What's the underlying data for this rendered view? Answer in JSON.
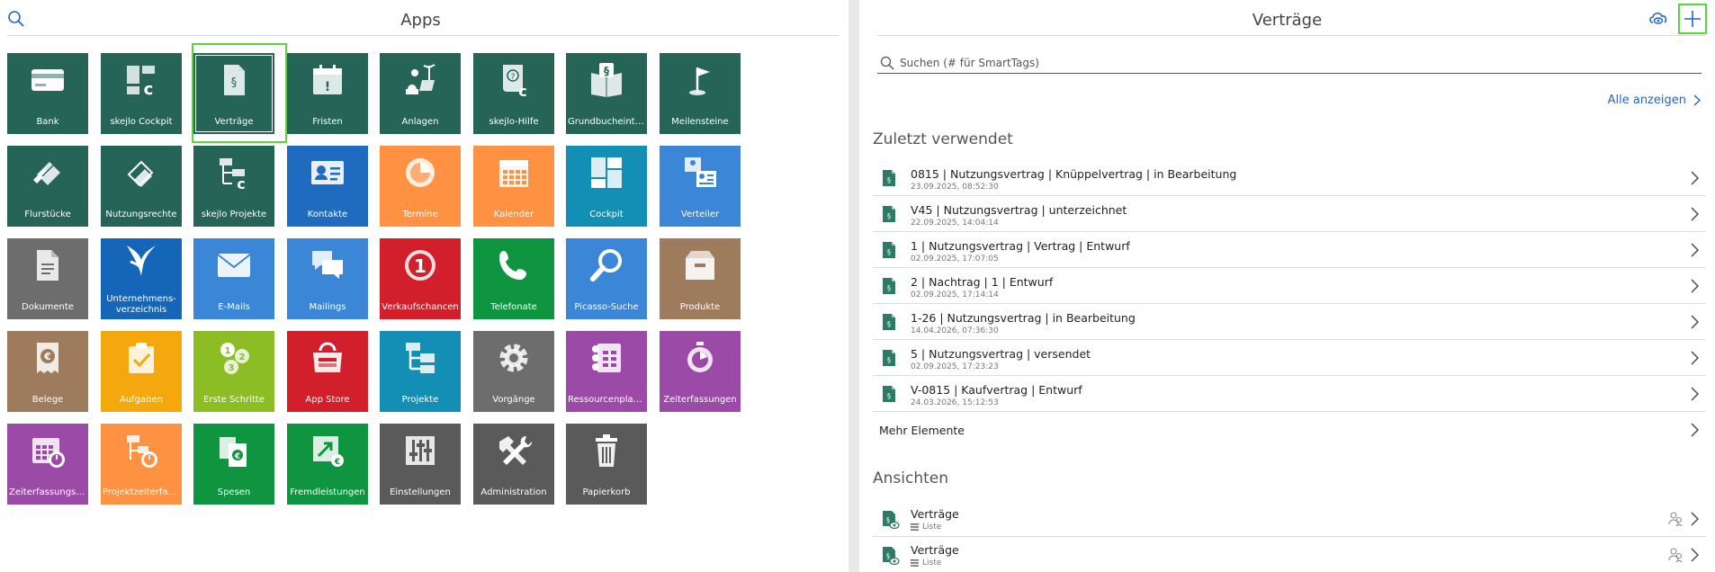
{
  "apps_panel": {
    "title": "Apps",
    "tiles": [
      {
        "label": "Bank",
        "color": "#256456",
        "icon": "card-icon"
      },
      {
        "label": "skejlo Cockpit",
        "color": "#256456",
        "icon": "cockpit-c-icon"
      },
      {
        "label": "Verträge",
        "color": "#256456",
        "icon": "contract-doc-icon",
        "selected": true
      },
      {
        "label": "Fristen",
        "color": "#256456",
        "icon": "deadline-calendar-icon"
      },
      {
        "label": "Anlagen",
        "color": "#256456",
        "icon": "energy-plant-icon"
      },
      {
        "label": "skejlo-Hilfe",
        "color": "#256456",
        "icon": "help-book-icon"
      },
      {
        "label": "Grundbucheintr…",
        "color": "#256456",
        "icon": "land-register-icon"
      },
      {
        "label": "Meilensteine",
        "color": "#256456",
        "icon": "milestone-flag-icon"
      },
      {
        "label": "Flurstücke",
        "color": "#256456",
        "icon": "parcel-icon"
      },
      {
        "label": "Nutzungsrechte",
        "color": "#256456",
        "icon": "usage-rights-icon"
      },
      {
        "label": "skejlo Projekte",
        "color": "#256456",
        "icon": "project-tree-c-icon"
      },
      {
        "label": "Kontakte",
        "color": "#1f6bbf",
        "icon": "contact-card-icon"
      },
      {
        "label": "Termine",
        "color": "#ff9142",
        "icon": "appointment-clock-icon"
      },
      {
        "label": "Kalender",
        "color": "#ff9142",
        "icon": "calendar-icon"
      },
      {
        "label": "Cockpit",
        "color": "#138fb5",
        "icon": "dashboard-icon"
      },
      {
        "label": "Verteiler",
        "color": "#3b86d6",
        "icon": "distribution-list-icon"
      },
      {
        "label": "Dokumente",
        "color": "#6d6d6d",
        "icon": "document-icon"
      },
      {
        "label": "Unternehmens-verzeichnis",
        "color": "#1566b8",
        "icon": "company-logo-icon"
      },
      {
        "label": "E-Mails",
        "color": "#3b86d6",
        "icon": "envelope-icon"
      },
      {
        "label": "Mailings",
        "color": "#3b86d6",
        "icon": "chat-bubbles-icon"
      },
      {
        "label": "Verkaufschancen",
        "color": "#d11f2b",
        "icon": "sales-opportunity-icon"
      },
      {
        "label": "Telefonate",
        "color": "#0f9440",
        "icon": "phone-icon"
      },
      {
        "label": "Picasso-Suche",
        "color": "#3b86d6",
        "icon": "magnifier-icon"
      },
      {
        "label": "Produkte",
        "color": "#9f7b5e",
        "icon": "product-box-icon"
      },
      {
        "label": "Belege",
        "color": "#9f7b5e",
        "icon": "receipt-euro-icon"
      },
      {
        "label": "Aufgaben",
        "color": "#f5a80d",
        "icon": "task-clipboard-icon"
      },
      {
        "label": "Erste Schritte",
        "color": "#8dbd24",
        "icon": "first-steps-icon"
      },
      {
        "label": "App Store",
        "color": "#d11f2b",
        "icon": "shopping-bag-icon"
      },
      {
        "label": "Projekte",
        "color": "#138fb5",
        "icon": "project-tree-icon"
      },
      {
        "label": "Vorgänge",
        "color": "#6d6d6d",
        "icon": "gear-icon"
      },
      {
        "label": "Ressourcenplan…",
        "color": "#9b4aa8",
        "icon": "resource-calculator-icon"
      },
      {
        "label": "Zeiterfassungen",
        "color": "#9b4aa8",
        "icon": "stopwatch-icon"
      },
      {
        "label": "Zeiterfassungsk…",
        "color": "#9b4aa8",
        "icon": "time-calendar-icon"
      },
      {
        "label": "Projektzeiterfass…",
        "color": "#ff9142",
        "icon": "project-time-icon"
      },
      {
        "label": "Spesen",
        "color": "#0f9440",
        "icon": "expenses-icon"
      },
      {
        "label": "Fremdleistungen",
        "color": "#0f9440",
        "icon": "external-service-icon"
      },
      {
        "label": "Einstellungen",
        "color": "#5a5a5a",
        "icon": "sliders-icon"
      },
      {
        "label": "Administration",
        "color": "#5a5a5a",
        "icon": "hammer-wrench-icon"
      },
      {
        "label": "Papierkorb",
        "color": "#5a5a5a",
        "icon": "trash-icon"
      }
    ]
  },
  "detail_panel": {
    "title": "Verträge",
    "search_placeholder": "Suchen (# für SmartTags)",
    "show_all_label": "Alle anzeigen",
    "recent_heading": "Zuletzt verwendet",
    "recent_items": [
      {
        "title": "0815 | Nutzungsvertrag | Knüppelvertrag | in Bearbeitung",
        "date": "23.09.2025, 08:52:30"
      },
      {
        "title": "V45 | Nutzungsvertrag | unterzeichnet",
        "date": "22.09.2025, 14:04:14"
      },
      {
        "title": "1 | Nutzungsvertrag | Vertrag | Entwurf",
        "date": "02.09.2025, 17:07:05"
      },
      {
        "title": "2 | Nachtrag | 1 | Entwurf",
        "date": "02.09.2025, 17:14:14"
      },
      {
        "title": "1-26 | Nutzungsvertrag | in Bearbeitung",
        "date": "14.04.2026, 07:36:30"
      },
      {
        "title": "5 | Nutzungsvertrag | versendet",
        "date": "02.09.2025, 17:23:23"
      },
      {
        "title": "V-0815 | Kaufvertrag | Entwurf",
        "date": "24.03.2026, 15:12:53"
      }
    ],
    "more_label": "Mehr Elemente",
    "views_heading": "Ansichten",
    "views": [
      {
        "title": "Verträge",
        "type": "Liste"
      },
      {
        "title": "Verträge",
        "type": "Liste"
      }
    ],
    "accent_color": "#2563c9",
    "highlight_color": "#58d638"
  }
}
